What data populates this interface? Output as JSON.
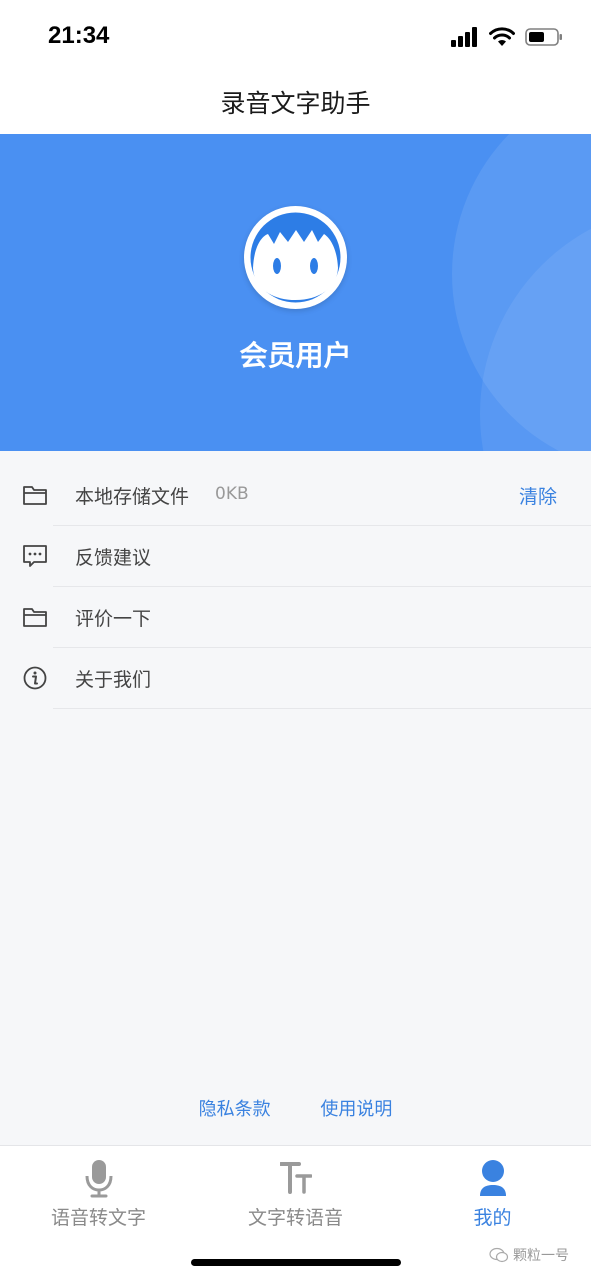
{
  "status": {
    "time": "21:34"
  },
  "nav": {
    "title": "录音文字助手"
  },
  "profile": {
    "name": "会员用户"
  },
  "menu": [
    {
      "label": "本地存储文件",
      "extra": "0KB",
      "action": "清除",
      "icon": "folder-icon"
    },
    {
      "label": "反馈建议",
      "icon": "feedback-icon"
    },
    {
      "label": "评价一下",
      "icon": "folder-icon"
    },
    {
      "label": "关于我们",
      "icon": "info-icon"
    }
  ],
  "footer": {
    "privacy": "隐私条款",
    "help": "使用说明"
  },
  "tabs": [
    {
      "label": "语音转文字",
      "icon": "microphone-icon",
      "active": false
    },
    {
      "label": "文字转语音",
      "icon": "text-size-icon",
      "active": false
    },
    {
      "label": "我的",
      "icon": "user-icon",
      "active": true
    }
  ],
  "watermark": "颗粒一号",
  "colors": {
    "accent": "#4a90f2",
    "link": "#3a82e0"
  }
}
